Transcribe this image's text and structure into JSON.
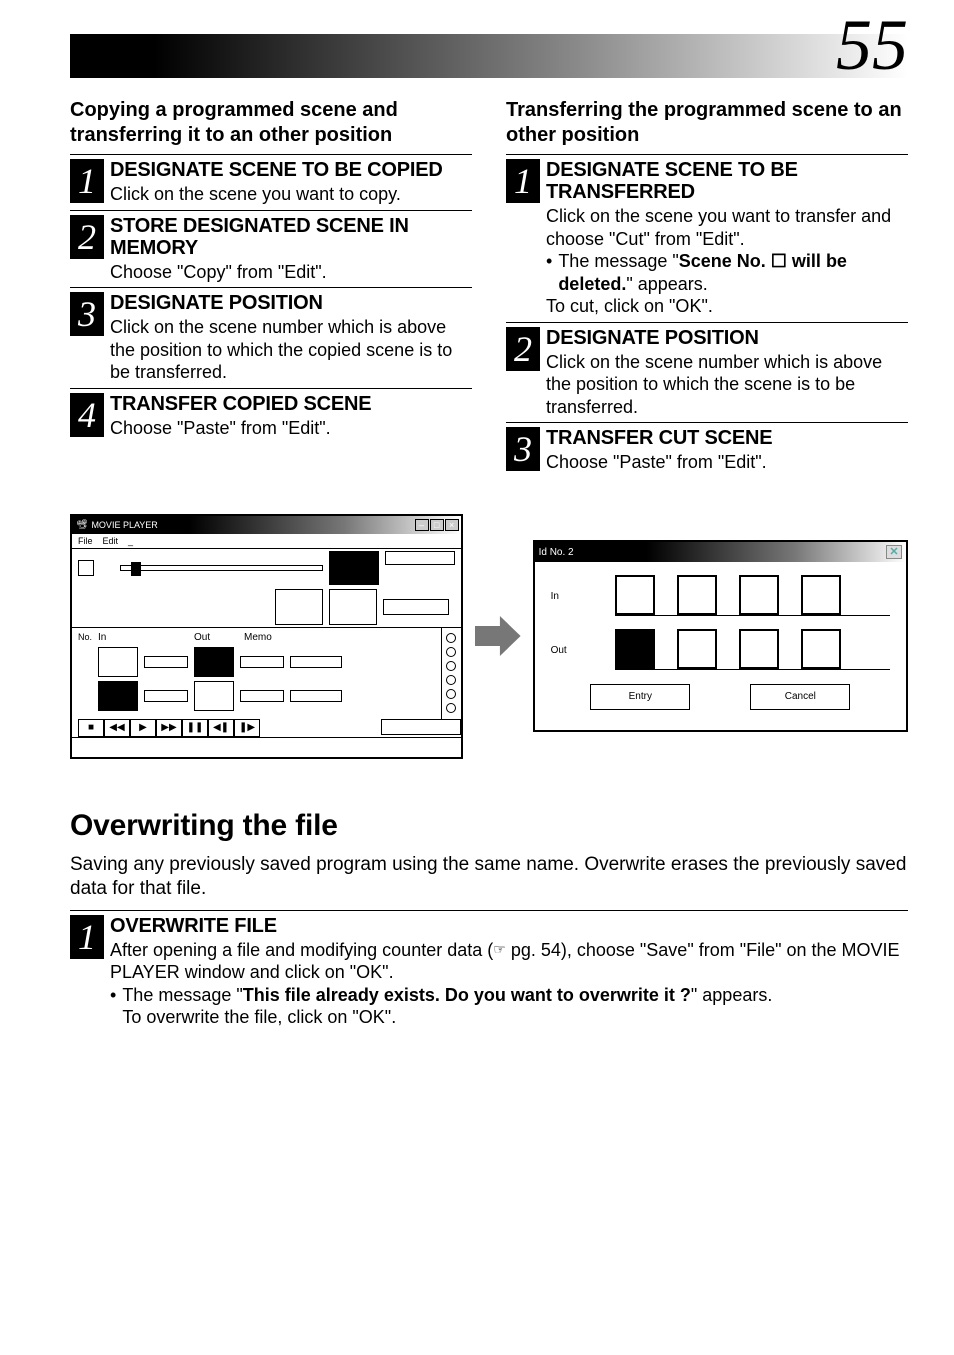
{
  "page_number": "55",
  "left": {
    "lead": "Copying a programmed scene and transferring it to an other position",
    "steps": [
      {
        "num": "1",
        "title": "DESIGNATE SCENE TO BE COPIED",
        "body": "Click on the scene you want to copy."
      },
      {
        "num": "2",
        "title": "STORE DESIGNATED SCENE IN MEMORY",
        "body": "Choose \"Copy\" from \"Edit\"."
      },
      {
        "num": "3",
        "title": "DESIGNATE POSITION",
        "body": "Click on the scene number which is above the position to which the copied scene is to be transferred."
      },
      {
        "num": "4",
        "title": "TRANSFER COPIED SCENE",
        "body": "Choose \"Paste\" from \"Edit\"."
      }
    ]
  },
  "right": {
    "lead": "Transferring the programmed scene to an other position",
    "steps": [
      {
        "num": "1",
        "title": "DESIGNATE SCENE TO BE TRANSFERRED",
        "body": "Click on the scene you want to transfer and choose \"Cut\" from \"Edit\".",
        "bullet_pre": "The message \"",
        "bullet_bold": "Scene No. ☐ will be deleted.",
        "bullet_post": "\" appears.",
        "after": "To cut, click on \"OK\"."
      },
      {
        "num": "2",
        "title": "DESIGNATE POSITION",
        "body": "Click on the scene number which is above the position to which the scene is to be transferred."
      },
      {
        "num": "3",
        "title": "TRANSFER CUT SCENE",
        "body": "Choose \"Paste\" from \"Edit\"."
      }
    ]
  },
  "movieplayer": {
    "title": "MOVIE PLAYER",
    "menus": [
      "File",
      "Edit",
      "_"
    ],
    "win_btns": [
      "–",
      "□",
      "×"
    ],
    "cols": [
      "No.",
      "In",
      "",
      "Out",
      "Memo"
    ],
    "transport": [
      "■",
      "◀◀",
      "▶",
      "▶▶",
      "❚❚",
      "◀❚",
      "❚▶"
    ]
  },
  "idwin": {
    "title": "Id No. 2",
    "rows": [
      "In",
      "Out"
    ],
    "btns": [
      "Entry",
      "Cancel"
    ],
    "close": "✕"
  },
  "overwrite": {
    "heading": "Overwriting the file",
    "lead": "Saving any previously saved program using the same name. Overwrite erases the previously saved data for that file.",
    "step_num": "1",
    "step_title": "OVERWRITE FILE",
    "step_body_before_ref": "After opening a file and modifying counter data (",
    "step_ref": "☞",
    "step_body_after_ref": " pg. 54), choose \"Save\" from \"File\" on the MOVIE PLAYER window and click on \"OK\".",
    "bullet_pre": "The message \"",
    "bullet_bold": "This file already exists. Do you want to overwrite it ?",
    "bullet_post": "\" appears.",
    "after": "To overwrite the file, click on \"OK\"."
  }
}
